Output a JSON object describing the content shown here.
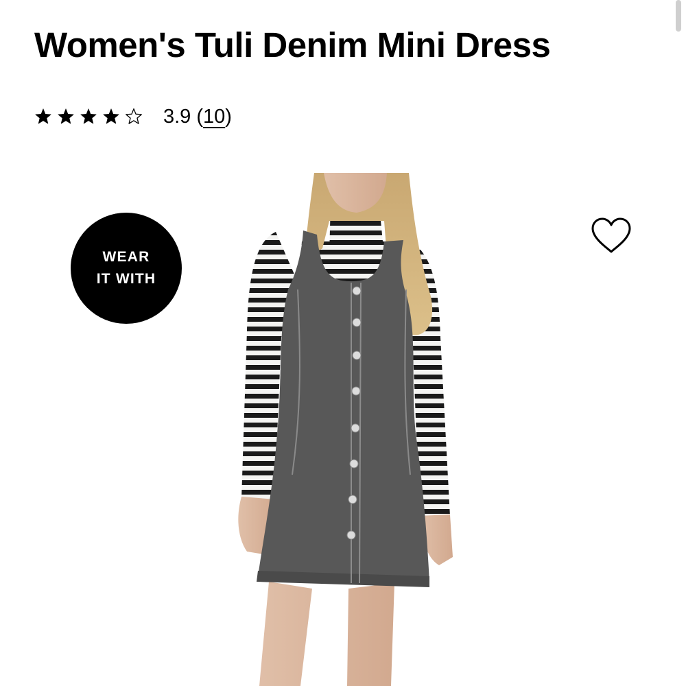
{
  "product": {
    "title": "Women's Tuli Denim Mini Dress",
    "rating": {
      "value": "3.9",
      "count_open": "(",
      "count": "10",
      "count_close": ")",
      "stars_filled": 4,
      "stars_total": 5
    }
  },
  "badge": {
    "line1": "WEAR",
    "line2": "IT WITH"
  },
  "icons": {
    "favorite": "heart-outline-icon",
    "star_filled": "star-filled-icon",
    "star_empty": "star-outline-icon"
  },
  "colors": {
    "text": "#000000",
    "badge_bg": "#000000",
    "badge_text": "#ffffff",
    "denim": "#555555"
  }
}
